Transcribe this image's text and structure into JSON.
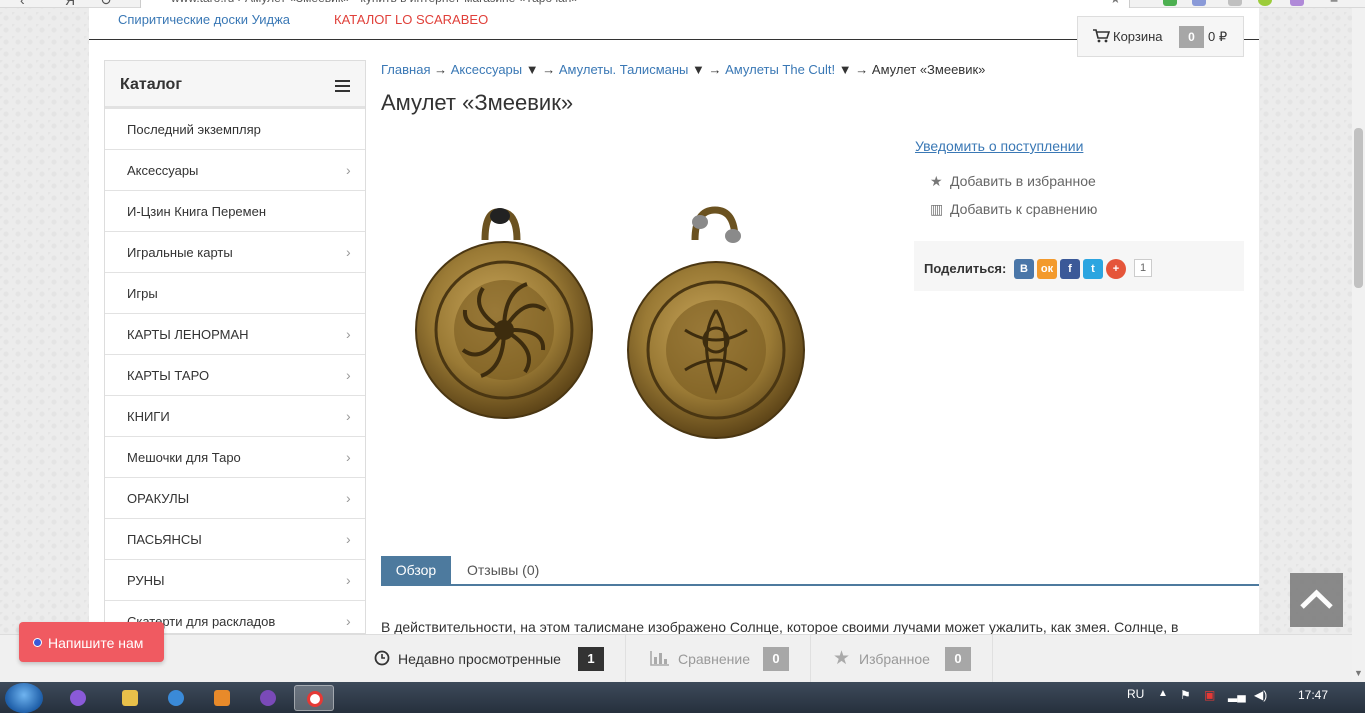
{
  "browser": {
    "url_text": "www.taro.ru › Амулет «Змеевик» - купить в интернет-магазине «Тарочан»"
  },
  "top_links": {
    "ouija": "Спиритические доски Уиджа",
    "scarabeo": "КАТАЛОГ LO SCARABEO"
  },
  "cart": {
    "label": "Корзина",
    "count": "0",
    "sum": "0 ₽"
  },
  "catalog": {
    "title": "Каталог",
    "items": [
      {
        "label": "Последний экземпляр",
        "chevron": ""
      },
      {
        "label": "Аксессуары",
        "chevron": "›"
      },
      {
        "label": "И-Цзин Книга Перемен",
        "chevron": ""
      },
      {
        "label": "Игральные карты",
        "chevron": "›"
      },
      {
        "label": "Игры",
        "chevron": ""
      },
      {
        "label": "КАРТЫ ЛЕНОРМАН",
        "chevron": "›"
      },
      {
        "label": "КАРТЫ ТАРО",
        "chevron": "›"
      },
      {
        "label": "КНИГИ",
        "chevron": "›"
      },
      {
        "label": "Мешочки для Таро",
        "chevron": "›"
      },
      {
        "label": "ОРАКУЛЫ",
        "chevron": "›"
      },
      {
        "label": "ПАСЬЯНСЫ",
        "chevron": "›"
      },
      {
        "label": "РУНЫ",
        "chevron": "›"
      },
      {
        "label": "Скатерти для раскладов",
        "chevron": "›"
      }
    ]
  },
  "breadcrumb": {
    "home": "Главная",
    "arrow": "→",
    "accessories": "Аксессуары",
    "down": "▼",
    "amulets": "Амулеты. Талисманы",
    "cult": "Амулеты The Cult!",
    "current": "Амулет «Змеевик»"
  },
  "product": {
    "title": "Амулет «Змеевик»",
    "notify": "Уведомить о поступлении",
    "add_favorite": "Добавить в избранное",
    "add_compare": "Добавить к сравнению",
    "share_label": "Поделиться:",
    "share_count": "1",
    "social": {
      "vk": "В",
      "ok": "ок",
      "fb": "f",
      "tw": "t",
      "plus": "+"
    }
  },
  "tabs": {
    "overview": "Обзор",
    "reviews": "Отзывы (0)"
  },
  "description": "В действительности, на этом талисмане изображено Солнце, которое своими лучами может ужалить, как змея. Солнце, в",
  "write_us": "Напишите нам",
  "bottom_bar": {
    "recent_label": "Недавно просмотренные",
    "recent_count": "1",
    "compare_label": "Сравнение",
    "compare_count": "0",
    "fav_label": "Избранное",
    "fav_count": "0"
  },
  "taskbar": {
    "lang": "RU",
    "time": "17:47"
  },
  "colors": {
    "link": "#3a78b5",
    "scarabeo": "#e0403a",
    "tab_active": "#4d7a9e",
    "write_us": "#f05a61",
    "count_dark": "#333333",
    "count_grey": "#a7a7a7"
  }
}
